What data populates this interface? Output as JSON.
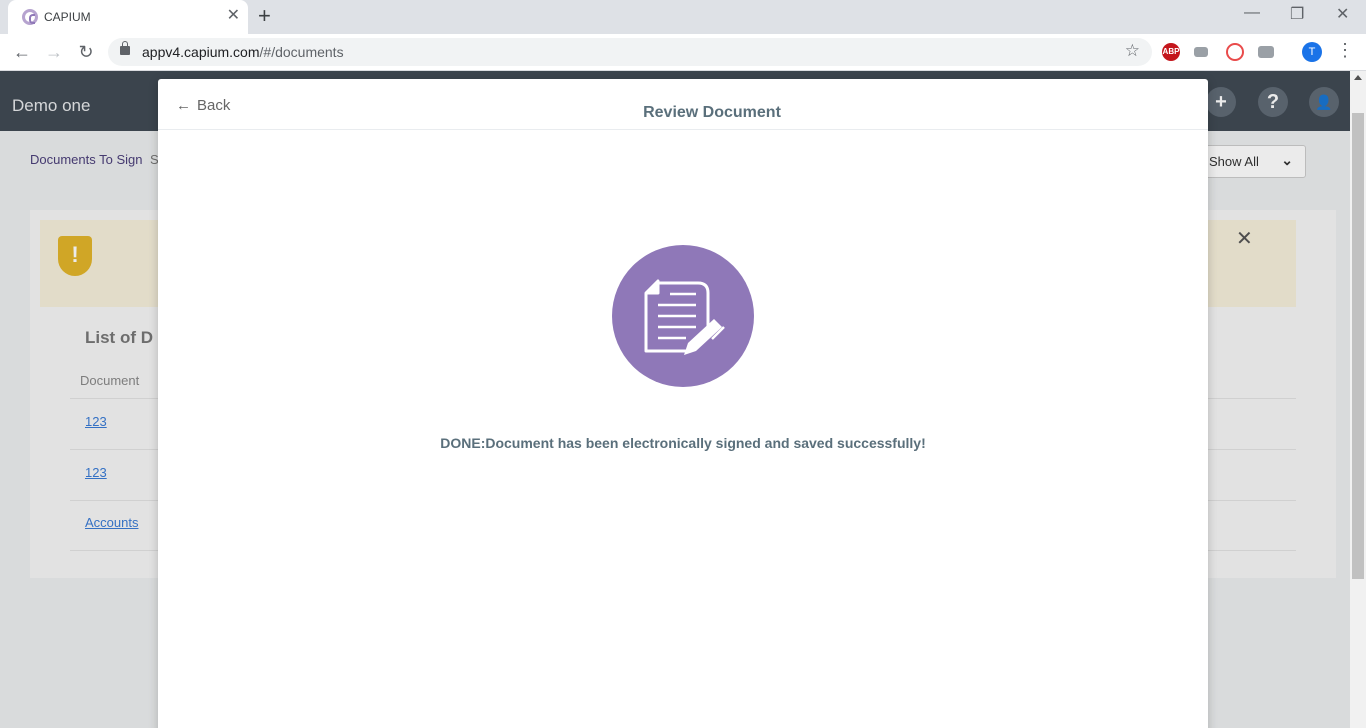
{
  "browser": {
    "tab_title": "CAPIUM",
    "tab_close": "✕",
    "new_tab": "+",
    "url_host": "appv4.capium.com",
    "url_path": "/#/documents",
    "profile_initial": "T",
    "abp_label": "ABP",
    "window_controls": {
      "minimize": "—",
      "restore": "❐",
      "close": "✕"
    }
  },
  "app": {
    "name": "Demo one",
    "header_buttons": {
      "add": "+",
      "help": "?",
      "profile": "👤"
    }
  },
  "subnav": {
    "active": "Documents To Sign",
    "next_partial": "S"
  },
  "filter": {
    "label": "Show All",
    "chevron": "⌄"
  },
  "alert": {
    "icon": "!",
    "close": "✕"
  },
  "list": {
    "title": "List of D",
    "column_document": "Document",
    "rows": [
      "123",
      "123",
      "Accounts"
    ]
  },
  "modal": {
    "back_label": "Back",
    "back_arrow": "←",
    "title": "Review Document",
    "message": "DONE:Document has been electronically signed and saved successfully!",
    "icon_color": "#8f78b8"
  }
}
